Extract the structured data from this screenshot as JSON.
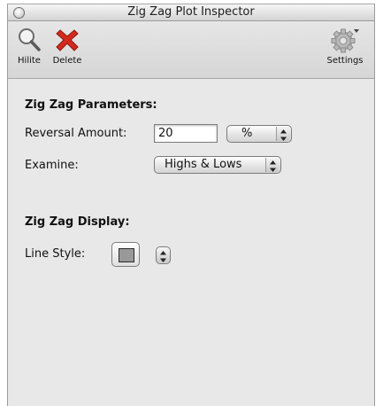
{
  "window": {
    "title": "Zig Zag Plot Inspector"
  },
  "toolbar": {
    "hilite_label": "Hilite",
    "delete_label": "Delete",
    "settings_label": "Settings",
    "icons": {
      "hilite": "magnifier-icon",
      "delete": "red-x-icon",
      "settings": "gear-icon"
    }
  },
  "parameters": {
    "title": "Zig Zag Parameters:",
    "reversal_label": "Reversal Amount:",
    "reversal_value": "20",
    "unit_value": "%",
    "examine_label": "Examine:",
    "examine_value": "Highs & Lows"
  },
  "display": {
    "title": "Zig Zag Display:",
    "line_style_label": "Line Style:",
    "line_color": "#999999"
  },
  "colors": {
    "delete_red": "#d42a1e",
    "window_bg": "#e8e8e8"
  }
}
